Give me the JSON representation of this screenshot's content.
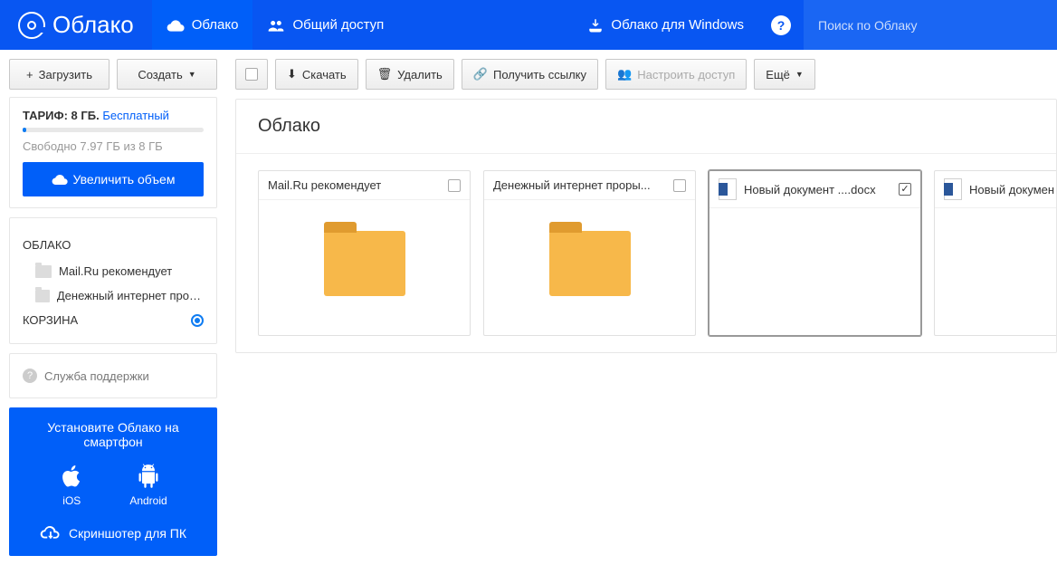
{
  "header": {
    "logo_text": "Облако",
    "nav_cloud": "Облако",
    "nav_shared": "Общий доступ",
    "nav_windows": "Облако для Windows",
    "search_placeholder": "Поиск по Облаку"
  },
  "sidebar": {
    "upload": "Загрузить",
    "create": "Создать",
    "tariff_label": "ТАРИФ: 8 ГБ.",
    "tariff_plan": "Бесплатный",
    "free_text": "Свободно 7.97 ГБ из 8 ГБ",
    "increase": "Увеличить объем",
    "cloud_section": "ОБЛАКО",
    "items": [
      {
        "label": "Mail.Ru рекомендует"
      },
      {
        "label": "Денежный интернет прорыв ..."
      }
    ],
    "trash": "КОРЗИНА",
    "support": "Служба поддержки",
    "smartphone": {
      "title": "Установите Облако на смартфон",
      "ios": "iOS",
      "android": "Android",
      "screenshoter": "Скриншотер для ПК"
    }
  },
  "toolbar": {
    "download": "Скачать",
    "delete": "Удалить",
    "get_link": "Получить ссылку",
    "configure_access": "Настроить доступ",
    "more": "Ещё"
  },
  "content": {
    "breadcrumb": "Облако",
    "files": [
      {
        "type": "folder",
        "name": "Mail.Ru рекомендует",
        "checked": false
      },
      {
        "type": "folder",
        "name": "Денежный интернет проры...",
        "checked": false
      },
      {
        "type": "docx",
        "name": "Новый документ ....docx",
        "checked": true
      },
      {
        "type": "docx",
        "name": "Новый докумен",
        "checked": false
      }
    ]
  }
}
